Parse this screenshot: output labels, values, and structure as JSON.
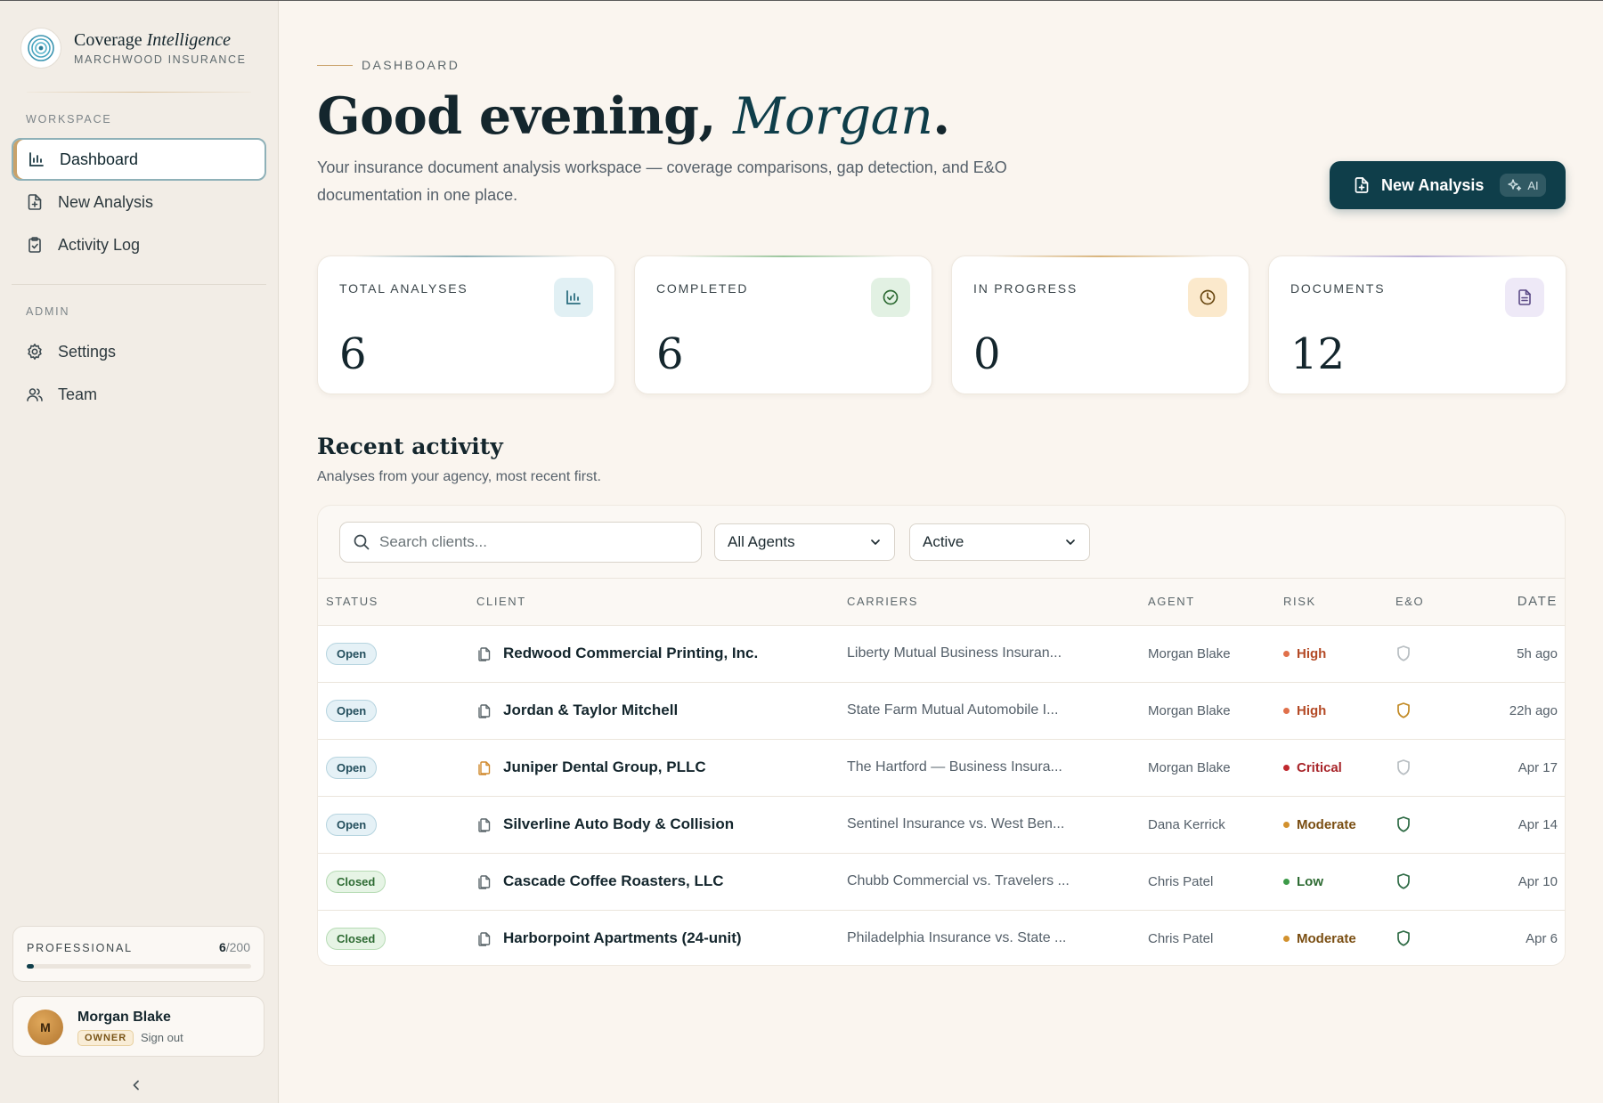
{
  "brand": {
    "title_main": "Coverage",
    "title_italic": "Intelligence",
    "subtitle": "MARCHWOOD INSURANCE"
  },
  "sidebar": {
    "workspace_label": "WORKSPACE",
    "admin_label": "ADMIN",
    "items": [
      {
        "label": "Dashboard",
        "icon": "bar-chart-icon",
        "active": true
      },
      {
        "label": "New Analysis",
        "icon": "file-plus-icon",
        "active": false
      },
      {
        "label": "Activity Log",
        "icon": "clipboard-check-icon",
        "active": false
      }
    ],
    "admin_items": [
      {
        "label": "Settings",
        "icon": "gear-icon"
      },
      {
        "label": "Team",
        "icon": "users-icon"
      }
    ],
    "plan": {
      "label": "PROFESSIONAL",
      "used": "6",
      "limit": "/200",
      "usage_fraction": 0.03
    },
    "user": {
      "initial": "M",
      "name": "Morgan Blake",
      "role": "OWNER",
      "signout": "Sign out"
    },
    "collapse_icon": "chevron-left-icon"
  },
  "header": {
    "kicker": "DASHBOARD",
    "greeting": "Good evening,",
    "name": "Morgan",
    "period": ".",
    "subtitle": "Your insurance document analysis workspace — coverage comparisons, gap detection, and E&O documentation in one place.",
    "new_analysis_label": "New Analysis",
    "ai_label": "AI"
  },
  "stats": [
    {
      "label": "TOTAL ANALYSES",
      "value": "6",
      "icon": "bar-chart-icon",
      "bg": "#e1f0f4",
      "fg": "#2d6f80",
      "accent": "#8fb1b8"
    },
    {
      "label": "COMPLETED",
      "value": "6",
      "icon": "check-circle-icon",
      "bg": "#e2f1e3",
      "fg": "#2e6b33",
      "accent": "#9cc79e"
    },
    {
      "label": "IN PROGRESS",
      "value": "0",
      "icon": "clock-icon",
      "bg": "#fbe9cc",
      "fg": "#6b4a14",
      "accent": "#d9b57d"
    },
    {
      "label": "DOCUMENTS",
      "value": "12",
      "icon": "document-icon",
      "bg": "#eee9f7",
      "fg": "#5b4a86",
      "accent": "#bdb2d7"
    }
  ],
  "activity": {
    "title": "Recent activity",
    "subtitle": "Analyses from your agency, most recent first.",
    "search_placeholder": "Search clients...",
    "agent_filter": "All Agents",
    "status_filter": "Active",
    "columns": [
      "STATUS",
      "CLIENT",
      "CARRIERS",
      "AGENT",
      "RISK",
      "E&O",
      "DATE"
    ],
    "rows": [
      {
        "status": "Open",
        "client": "Redwood Commercial Printing, Inc.",
        "doc_color": "#5c676b",
        "carriers": "Liberty Mutual Business Insuran...",
        "agent": "Morgan Blake",
        "risk": "High",
        "risk_color": "#b44a26",
        "dot_color": "#e0704a",
        "eo_color": "#b8bec2",
        "date": "5h ago"
      },
      {
        "status": "Open",
        "client": "Jordan & Taylor Mitchell",
        "doc_color": "#5c676b",
        "carriers": "State Farm Mutual Automobile I...",
        "agent": "Morgan Blake",
        "risk": "High",
        "risk_color": "#b44a26",
        "dot_color": "#e0704a",
        "eo_color": "#c28a25",
        "date": "22h ago"
      },
      {
        "status": "Open",
        "client": "Juniper Dental Group, PLLC",
        "doc_color": "#d08a2e",
        "carriers": "The Hartford — Business Insura...",
        "agent": "Morgan Blake",
        "risk": "Critical",
        "risk_color": "#a8252a",
        "dot_color": "#c0282e",
        "eo_color": "#b8bec2",
        "date": "Apr 17"
      },
      {
        "status": "Open",
        "client": "Silverline Auto Body & Collision",
        "doc_color": "#5c676b",
        "carriers": "Sentinel Insurance vs. West Ben...",
        "agent": "Dana Kerrick",
        "risk": "Moderate",
        "risk_color": "#7a4e12",
        "dot_color": "#d2912e",
        "eo_color": "#2e6b45",
        "date": "Apr 14"
      },
      {
        "status": "Closed",
        "client": "Cascade Coffee Roasters, LLC",
        "doc_color": "#5c676b",
        "carriers": "Chubb Commercial vs. Travelers ...",
        "agent": "Chris Patel",
        "risk": "Low",
        "risk_color": "#2e6b33",
        "dot_color": "#3c9a48",
        "eo_color": "#2e6b45",
        "date": "Apr 10"
      },
      {
        "status": "Closed",
        "client": "Harborpoint Apartments (24-unit)",
        "doc_color": "#5c676b",
        "carriers": "Philadelphia Insurance vs. State ...",
        "agent": "Chris Patel",
        "risk": "Moderate",
        "risk_color": "#7a4e12",
        "dot_color": "#d2912e",
        "eo_color": "#2e6b45",
        "date": "Apr 6"
      }
    ]
  }
}
